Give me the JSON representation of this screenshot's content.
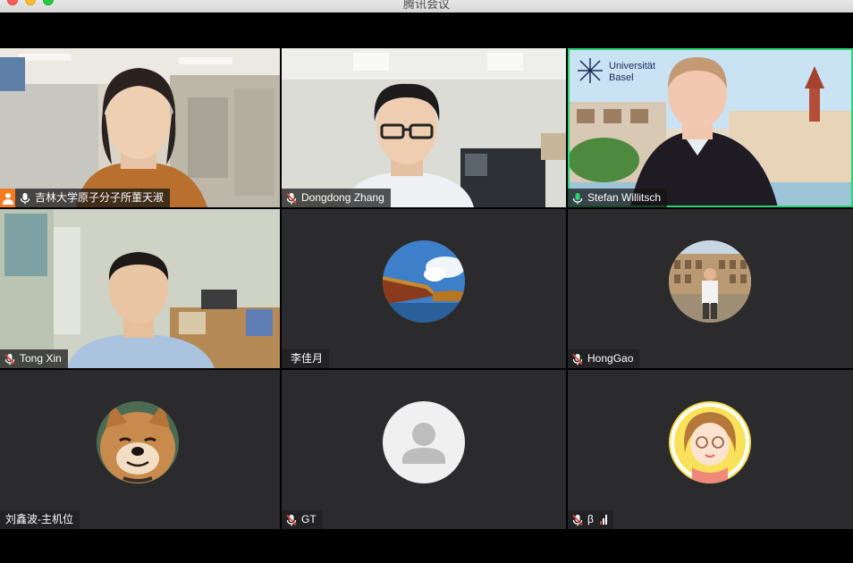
{
  "window": {
    "title": "腾讯会议"
  },
  "participants": [
    {
      "name": "吉林大学原子分子所董天淑",
      "mic": "on",
      "host": true,
      "speaking": false,
      "kind": "video-woman"
    },
    {
      "name": "Dongdong Zhang",
      "mic": "muted",
      "host": false,
      "speaking": false,
      "kind": "video-man-glasses"
    },
    {
      "name": "Stefan Willitsch",
      "mic": "on",
      "host": false,
      "speaking": true,
      "kind": "video-basel",
      "logo_text_1": "Universität",
      "logo_text_2": "Basel"
    },
    {
      "name": "Tong Xin",
      "mic": "muted",
      "host": false,
      "speaking": false,
      "kind": "video-man-office"
    },
    {
      "name": "李佳月",
      "mic": "none",
      "host": false,
      "speaking": false,
      "kind": "avatar-roof"
    },
    {
      "name": "HongGao",
      "mic": "muted",
      "host": false,
      "speaking": false,
      "kind": "avatar-colosseum"
    },
    {
      "name": "刘鑫波-主机位",
      "mic": "none",
      "host": false,
      "speaking": false,
      "kind": "avatar-dog"
    },
    {
      "name": "GT",
      "mic": "muted",
      "host": false,
      "speaking": false,
      "kind": "avatar-default"
    },
    {
      "name": "β",
      "mic": "muted",
      "host": false,
      "speaking": false,
      "kind": "avatar-cartoon-girl",
      "weak_signal": true
    }
  ],
  "colors": {
    "speaking_border": "#2bd473",
    "muted_mic": "#e0453a",
    "tile_bg": "#2b2b2d",
    "host_badge": "#f57b20"
  }
}
